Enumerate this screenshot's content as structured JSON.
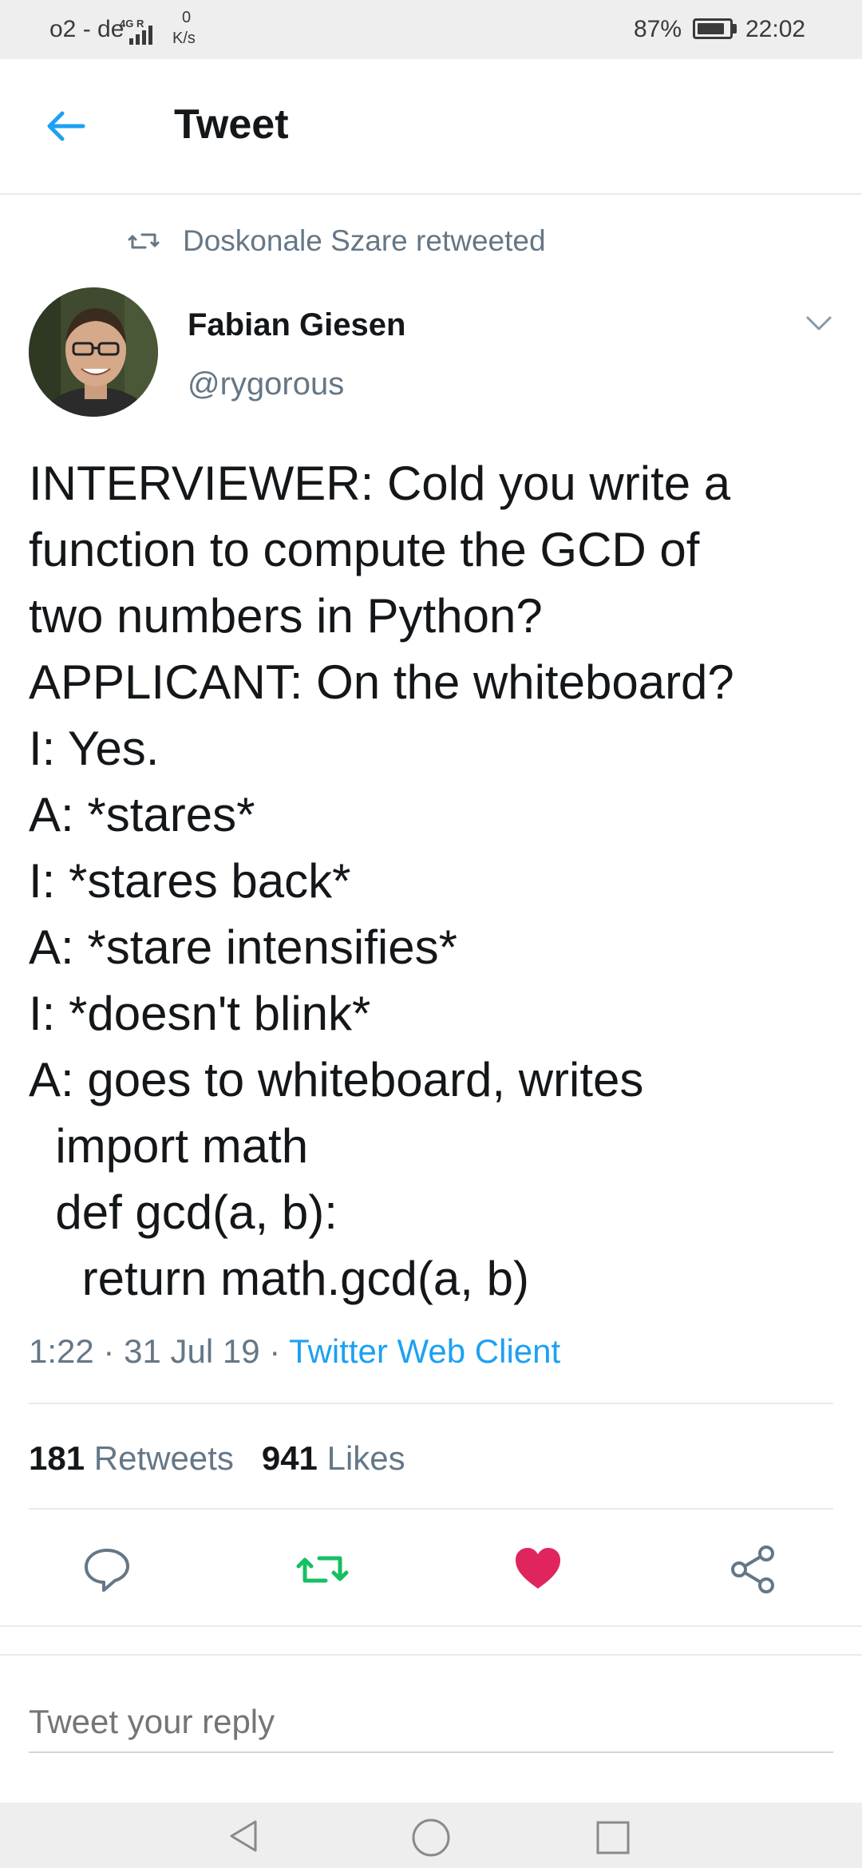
{
  "status_bar": {
    "carrier": "o2 - de",
    "network": "4G R",
    "speed_value": "0",
    "speed_unit": "K/s",
    "battery": "87%",
    "battery_level": 0.87,
    "time": "22:02"
  },
  "header": {
    "title": "Tweet",
    "back_icon": "arrow-left-icon"
  },
  "retweet": {
    "label": "Doskonale Szare retweeted",
    "icon": "retweet-icon"
  },
  "author": {
    "name": "Fabian Giesen",
    "handle": "@rygorous",
    "menu_icon": "chevron-down-icon"
  },
  "tweet": {
    "lines": [
      "INTERVIEWER: Cold you write a",
      "function to compute the GCD of",
      "two numbers in Python?",
      "APPLICANT: On the whiteboard?",
      "I: Yes.",
      "A: *stares*",
      "I: *stares back*",
      "A: *stare intensifies*",
      "I: *doesn't blink*",
      "A: goes to whiteboard, writes",
      "  import math",
      "  def gcd(a, b):",
      "    return math.gcd(a, b)"
    ],
    "time": "1:22",
    "date": "31 Jul 19",
    "separator": "·",
    "source": "Twitter Web Client"
  },
  "stats": {
    "retweets_count": "181",
    "retweets_label": "Retweets",
    "likes_count": "941",
    "likes_label": "Likes"
  },
  "actions": {
    "reply_icon": "comment-icon",
    "retweet_icon": "retweet-icon",
    "like_icon": "heart-icon",
    "share_icon": "share-icon",
    "retweet_color": "#17bf63",
    "like_color": "#e0245e"
  },
  "reply": {
    "placeholder": "Tweet your reply"
  },
  "colors": {
    "accent": "#1da1f2",
    "secondary_text": "#657786",
    "primary_text": "#14171a"
  }
}
